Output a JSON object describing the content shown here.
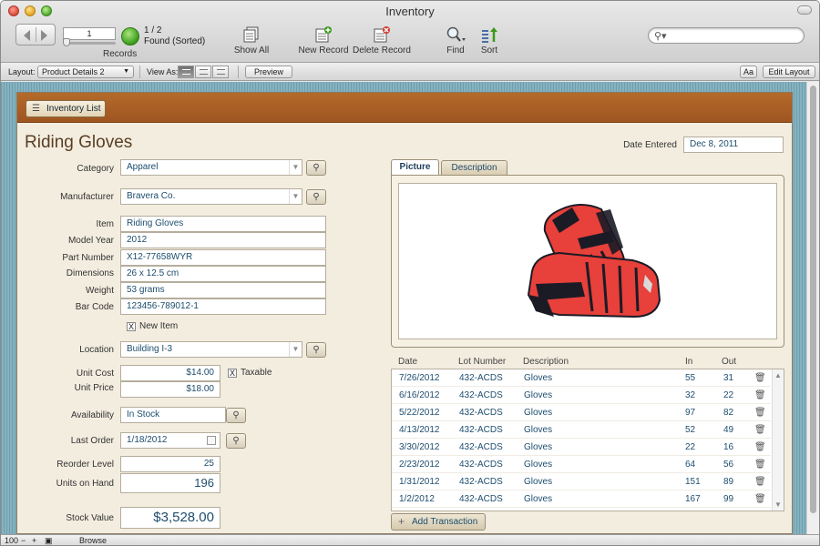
{
  "window": {
    "title": "Inventory"
  },
  "toolbar": {
    "record_number": "1",
    "record_count": "1 / 2",
    "found_status": "Found (Sorted)",
    "records_label": "Records",
    "show_all_label": "Show All",
    "new_record_label": "New Record",
    "delete_record_label": "Delete Record",
    "find_label": "Find",
    "sort_label": "Sort",
    "search_placeholder": ""
  },
  "layout_bar": {
    "layout_label": "Layout:",
    "layout_value": "Product Details 2",
    "view_as_label": "View As:",
    "preview_label": "Preview",
    "font_size_label": "Aa",
    "edit_layout_label": "Edit Layout"
  },
  "header": {
    "inventory_list_label": "Inventory List"
  },
  "record": {
    "title": "Riding Gloves",
    "date_entered_label": "Date Entered",
    "date_entered": "Dec 8, 2011",
    "category_label": "Category",
    "category": "Apparel",
    "manufacturer_label": "Manufacturer",
    "manufacturer": "Bravera Co.",
    "item_label": "Item",
    "item": "Riding Gloves",
    "model_year_label": "Model Year",
    "model_year": "2012",
    "part_number_label": "Part Number",
    "part_number": "X12-77658WYR",
    "dimensions_label": "Dimensions",
    "dimensions": "26 x 12.5 cm",
    "weight_label": "Weight",
    "weight": "53 grams",
    "bar_code_label": "Bar Code",
    "bar_code": "123456-789012-1",
    "new_item_label": "New Item",
    "new_item_checked": "X",
    "location_label": "Location",
    "location": "Building I-3",
    "unit_cost_label": "Unit Cost",
    "unit_cost": "$14.00",
    "taxable_label": "Taxable",
    "taxable_checked": "X",
    "unit_price_label": "Unit Price",
    "unit_price": "$18.00",
    "availability_label": "Availability",
    "availability": "In Stock",
    "last_order_label": "Last Order",
    "last_order": "1/18/2012",
    "reorder_level_label": "Reorder Level",
    "reorder_level": "25",
    "units_on_hand_label": "Units on Hand",
    "units_on_hand": "196",
    "stock_value_label": "Stock Value",
    "stock_value": "$3,528.00"
  },
  "tabs": {
    "picture": "Picture",
    "description": "Description"
  },
  "transactions": {
    "headers": {
      "date": "Date",
      "lot": "Lot Number",
      "desc": "Description",
      "in": "In",
      "out": "Out"
    },
    "rows": [
      {
        "date": "7/26/2012",
        "lot": "432-ACDS",
        "desc": "Gloves",
        "in": "55",
        "out": "31"
      },
      {
        "date": "6/16/2012",
        "lot": "432-ACDS",
        "desc": "Gloves",
        "in": "32",
        "out": "22"
      },
      {
        "date": "5/22/2012",
        "lot": "432-ACDS",
        "desc": "Gloves",
        "in": "97",
        "out": "82"
      },
      {
        "date": "4/13/2012",
        "lot": "432-ACDS",
        "desc": "Gloves",
        "in": "52",
        "out": "49"
      },
      {
        "date": "3/30/2012",
        "lot": "432-ACDS",
        "desc": "Gloves",
        "in": "22",
        "out": "16"
      },
      {
        "date": "2/23/2012",
        "lot": "432-ACDS",
        "desc": "Gloves",
        "in": "64",
        "out": "56"
      },
      {
        "date": "1/31/2012",
        "lot": "432-ACDS",
        "desc": "Gloves",
        "in": "151",
        "out": "89"
      },
      {
        "date": "1/2/2012",
        "lot": "432-ACDS",
        "desc": "Gloves",
        "in": "167",
        "out": "99"
      }
    ],
    "add_label": "Add Transaction"
  },
  "status_bar": {
    "zoom": "100",
    "mode": "Browse"
  },
  "colors": {
    "header_brown": "#a85c22",
    "panel_bg": "#f3ede0",
    "value_text": "#1d4d6e",
    "glove_red": "#e8403a"
  }
}
